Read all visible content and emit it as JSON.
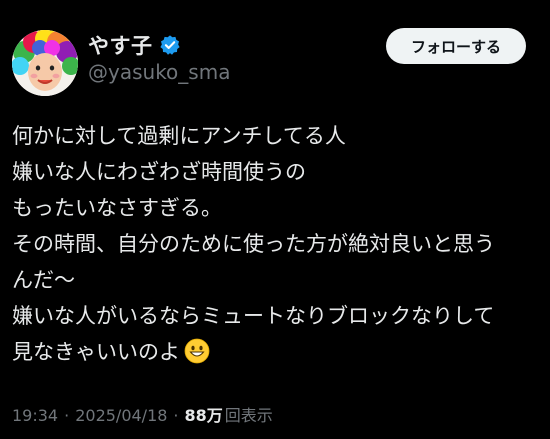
{
  "user": {
    "display_name": "やす子",
    "handle": "@yasuko_sma",
    "verified": true,
    "avatar_icon": "profile-avatar-rainbow-wig"
  },
  "follow_button": {
    "label": "フォローする"
  },
  "tweet": {
    "lines": [
      "何かに対して過剰にアンチしてる人",
      "嫌いな人にわざわざ時間使うの",
      "もったいなさすぎる。",
      "その時間、自分のために使った方が絶対良いと思う",
      "んだ〜",
      "嫌いな人がいるならミュートなりブロックなりして",
      "見なきゃいいのよ"
    ],
    "trailing_emoji": "grinning-face-emoji"
  },
  "meta": {
    "time": "19:34",
    "separator": "·",
    "date": "2025/04/18",
    "views_count": "88万",
    "views_label": "回表示"
  },
  "colors": {
    "background": "#000000",
    "primary_text": "#e7e9ea",
    "secondary_text": "#71767b",
    "verified_blue": "#1d9bf0",
    "button_bg": "#eff3f4",
    "button_text": "#0f1419"
  }
}
